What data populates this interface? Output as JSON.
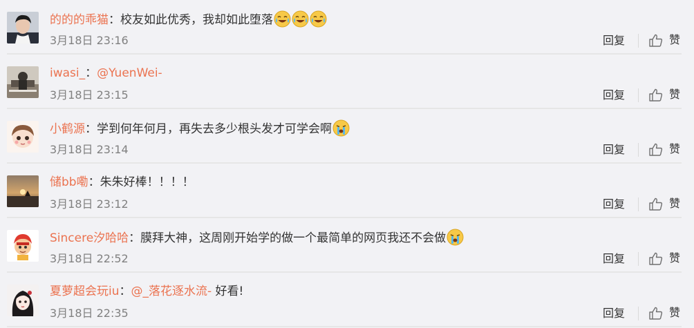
{
  "comments": [
    {
      "user": "的的的乖猫",
      "segments": [
        {
          "kind": "text",
          "value": "校友如此优秀，我却如此堕落"
        }
      ],
      "emojis": [
        "laugh-cry-icon",
        "laugh-cry-icon",
        "laugh-cry-icon"
      ],
      "time": "3月18日 23:16",
      "avatar": "avatar-boy-photo"
    },
    {
      "user": "iwasi_",
      "segments": [
        {
          "kind": "mention",
          "value": "@YuenWei-"
        }
      ],
      "emojis": [],
      "time": "3月18日 23:15",
      "avatar": "avatar-desk-photo"
    },
    {
      "user": "小鹤源",
      "segments": [
        {
          "kind": "text",
          "value": "学到何年何月，再失去多少根头发才可学会啊"
        }
      ],
      "emojis": [
        "crying-icon"
      ],
      "time": "3月18日 23:14",
      "avatar": "avatar-cartoon-girl"
    },
    {
      "user": "储bb嘞",
      "segments": [
        {
          "kind": "text",
          "value": "朱朱好棒！！！！"
        }
      ],
      "emojis": [],
      "time": "3月18日 23:12",
      "avatar": "avatar-sunset-photo"
    },
    {
      "user": "Sincere汐哈哈",
      "segments": [
        {
          "kind": "text",
          "value": "膜拜大神，这周刚开始学的做一个最简单的网页我还不会做"
        }
      ],
      "emojis": [
        "crying-icon"
      ],
      "time": "3月18日 22:52",
      "avatar": "avatar-cartoon-character"
    },
    {
      "user": "夏萝超会玩iu",
      "segments": [
        {
          "kind": "mention",
          "value": "@_落花逐水流-"
        },
        {
          "kind": "text",
          "value": " 好看!"
        }
      ],
      "emojis": [],
      "time": "3月18日 22:35",
      "avatar": "avatar-anime-girl"
    }
  ],
  "actions": {
    "reply_label": "回复",
    "like_label": "赞"
  },
  "colors": {
    "username": "#eb7350",
    "time": "#808080",
    "background": "#f2f2f5",
    "separator": "#e6e6e6"
  }
}
